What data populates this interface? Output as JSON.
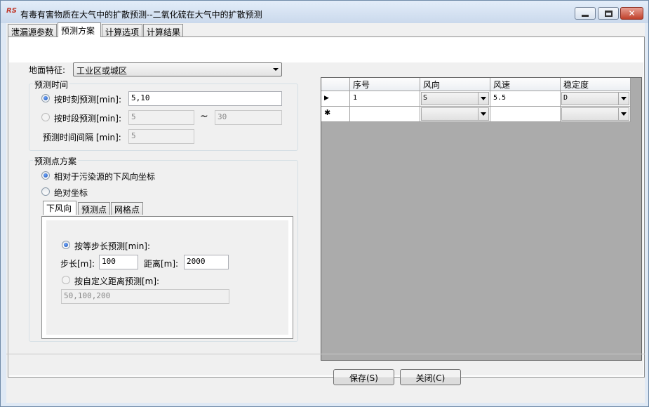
{
  "window": {
    "title": "有毒有害物质在大气中的扩散预测--二氧化硫在大气中的扩散预测",
    "app_icon": "RS"
  },
  "main_tabs": [
    "泄漏源参数",
    "预测方案",
    "计算选项",
    "计算结果"
  ],
  "active_main_tab": "预测方案",
  "ground": {
    "label": "地面特征:",
    "value": "工业区或城区"
  },
  "time": {
    "group_title": "预测时间",
    "by_moment_label": "按时刻预测[min]:",
    "by_moment_value": "5,10",
    "by_period_label": "按时段预测[min]:",
    "period_from": "5",
    "period_sep": "~",
    "period_to": "30",
    "interval_label": "预测时间间隔 [min]:",
    "interval_value": "5"
  },
  "points": {
    "group_title": "预测点方案",
    "relative_label": "相对于污染源的下风向坐标",
    "absolute_label": "绝对坐标",
    "subtabs": [
      "下风向",
      "预测点",
      "网格点"
    ],
    "equal_step_label": "按等步长预测[min]:",
    "step_label": "步长[m]:",
    "step_value": "100",
    "distance_label": "距离[m]:",
    "distance_value": "2000",
    "custom_label": "按自定义距离预测[m]:",
    "custom_value": "50,100,200"
  },
  "grid": {
    "columns": [
      "序号",
      "风向",
      "风速",
      "稳定度"
    ],
    "rows": [
      {
        "marker": "▶",
        "index": "1",
        "direction": "S",
        "speed": "5.5",
        "stability": "D"
      },
      {
        "marker": "✱",
        "index": "",
        "direction": "",
        "speed": "",
        "stability": ""
      }
    ]
  },
  "buttons": {
    "save": "保存(S)",
    "close": "关闭(C)"
  }
}
